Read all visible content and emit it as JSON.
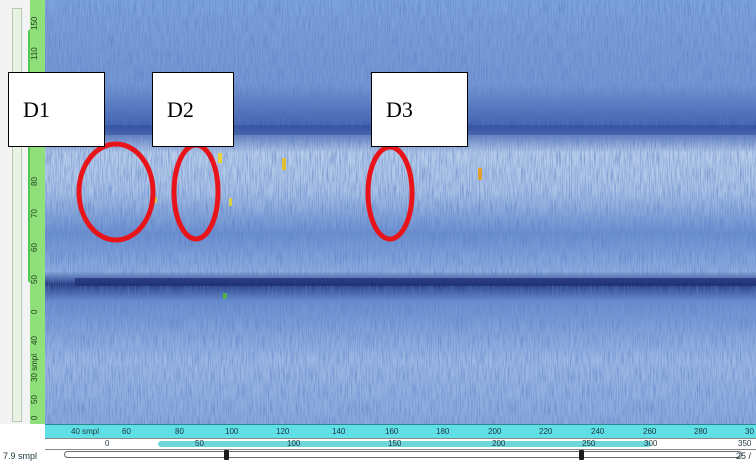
{
  "defect_labels": [
    "D1",
    "D2",
    "D3"
  ],
  "left_ruler": {
    "ticks": [
      "150",
      "110",
      "80",
      "70",
      "60",
      "50",
      "0",
      "40",
      "30 smpl",
      "50",
      "0"
    ]
  },
  "top_ruler": {
    "ticks": [
      "40 smpl",
      "60",
      "80",
      "100",
      "120",
      "140",
      "160",
      "180",
      "200",
      "220",
      "240",
      "260",
      "280",
      "30"
    ]
  },
  "mid_ruler": {
    "ticks": [
      "0",
      "50",
      "100",
      "150",
      "200",
      "250",
      "300",
      "350"
    ]
  },
  "bottom_bar": {
    "left_label": "7.9 smpl",
    "right_label": "25 /"
  },
  "colors": {
    "scan_background": "#8fb0e0",
    "defect_circle": "#e8141a",
    "ruler": "#5fe0e6",
    "scale": "#8fe07a"
  }
}
